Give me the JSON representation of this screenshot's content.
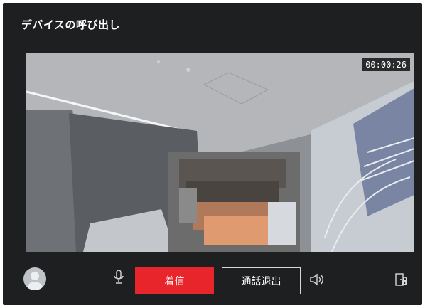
{
  "dialog": {
    "title": "デバイスの呼び出し"
  },
  "video": {
    "timer": "00:00:26"
  },
  "controls": {
    "answer_label": "着信",
    "hangup_label": "通話退出",
    "icons": {
      "avatar": "user-avatar-icon",
      "mic": "microphone-icon",
      "speaker": "speaker-icon",
      "unlock": "door-unlock-icon"
    },
    "colors": {
      "answer": "#e8252b",
      "background": "#1e1f21"
    }
  }
}
